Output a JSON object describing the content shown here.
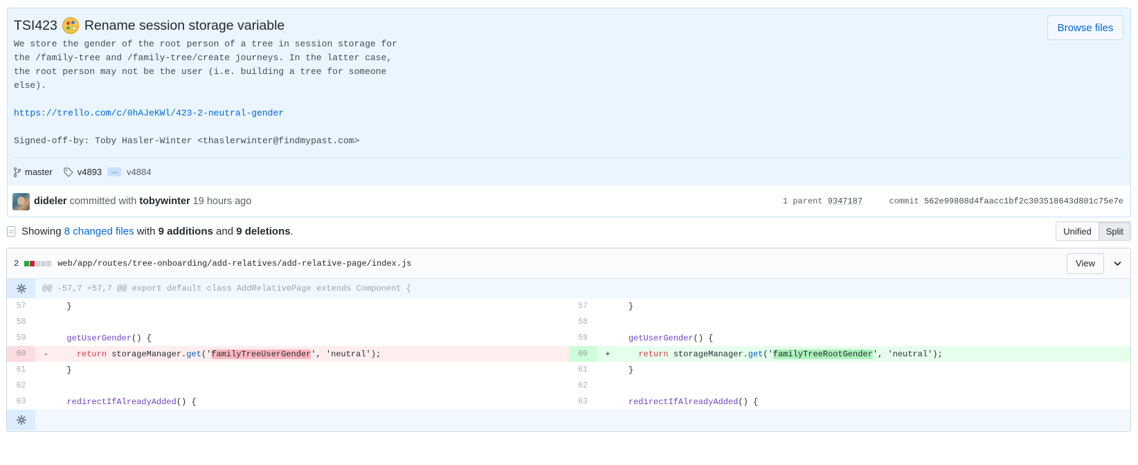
{
  "commit": {
    "title_prefix": "TSI423",
    "title_text": "Rename session storage variable",
    "description": "We store the gender of the root person of a tree in session storage for\nthe /family-tree and /family-tree/create journeys. In the latter case,\nthe root person may not be the user (i.e. building a tree for someone\nelse).",
    "link": "https://trello.com/c/0hAJeKWl/423-2-neutral-gender",
    "signoff": "Signed-off-by: Toby Hasler-Winter <thaslerwinter@findmypast.com>",
    "browse_label": "Browse files",
    "branch": "master",
    "tag_from": "v4893",
    "tag_ellipsis": "…",
    "tag_to": "v4884",
    "author": "dideler",
    "committed_with": "committed with",
    "committer": "tobywinter",
    "time": "19 hours ago",
    "parent_label": "1 parent",
    "parent_sha": "9347187",
    "commit_label": "commit",
    "commit_sha": "562e99808d4faacc1bf2c303518643d801c75e7e"
  },
  "toc": {
    "showing": "Showing",
    "changed_files": "8 changed files",
    "with": "with",
    "additions": "9 additions",
    "and": "and",
    "deletions": "9 deletions",
    "period": ".",
    "unified": "Unified",
    "split": "Split"
  },
  "file": {
    "count": "2",
    "path": "web/app/routes/tree-onboarding/add-relatives/add-relative-page/index.js",
    "view_label": "View",
    "hunk": "@@ -57,7 +57,7 @@ export default class AddRelativePage extends Component {"
  },
  "diff": {
    "left": [
      {
        "num": "57",
        "mark": "",
        "type": "ctx"
      },
      {
        "num": "58",
        "mark": "",
        "type": "ctx"
      },
      {
        "num": "59",
        "mark": "",
        "type": "ctx"
      },
      {
        "num": "60",
        "mark": "-",
        "type": "del"
      },
      {
        "num": "61",
        "mark": "",
        "type": "ctx"
      },
      {
        "num": "62",
        "mark": "",
        "type": "ctx"
      },
      {
        "num": "63",
        "mark": "",
        "type": "ctx"
      }
    ],
    "right": [
      {
        "num": "57",
        "mark": "",
        "type": "ctx"
      },
      {
        "num": "58",
        "mark": "",
        "type": "ctx"
      },
      {
        "num": "59",
        "mark": "",
        "type": "ctx"
      },
      {
        "num": "60",
        "mark": "+",
        "type": "add"
      },
      {
        "num": "61",
        "mark": "",
        "type": "ctx"
      },
      {
        "num": "62",
        "mark": "",
        "type": "ctx"
      },
      {
        "num": "63",
        "mark": "",
        "type": "ctx"
      }
    ],
    "brace_close": "}",
    "fn_get": "getUserGender",
    "fn_get_tail": "() {",
    "ret": "return",
    "storage": "storageManager.",
    "get": "get",
    "open": "('",
    "old_key": "familyTreeUserGender",
    "new_key": "familyTreeRootGender",
    "mid": "', '",
    "neutral": "neutral",
    "close": "');",
    "fn_redirect": "redirectIfAlreadyAdded",
    "fn_redirect_tail": "() {"
  },
  "colors": {
    "link": "#0366d6",
    "addition": "#28a745",
    "deletion": "#cb2431"
  }
}
